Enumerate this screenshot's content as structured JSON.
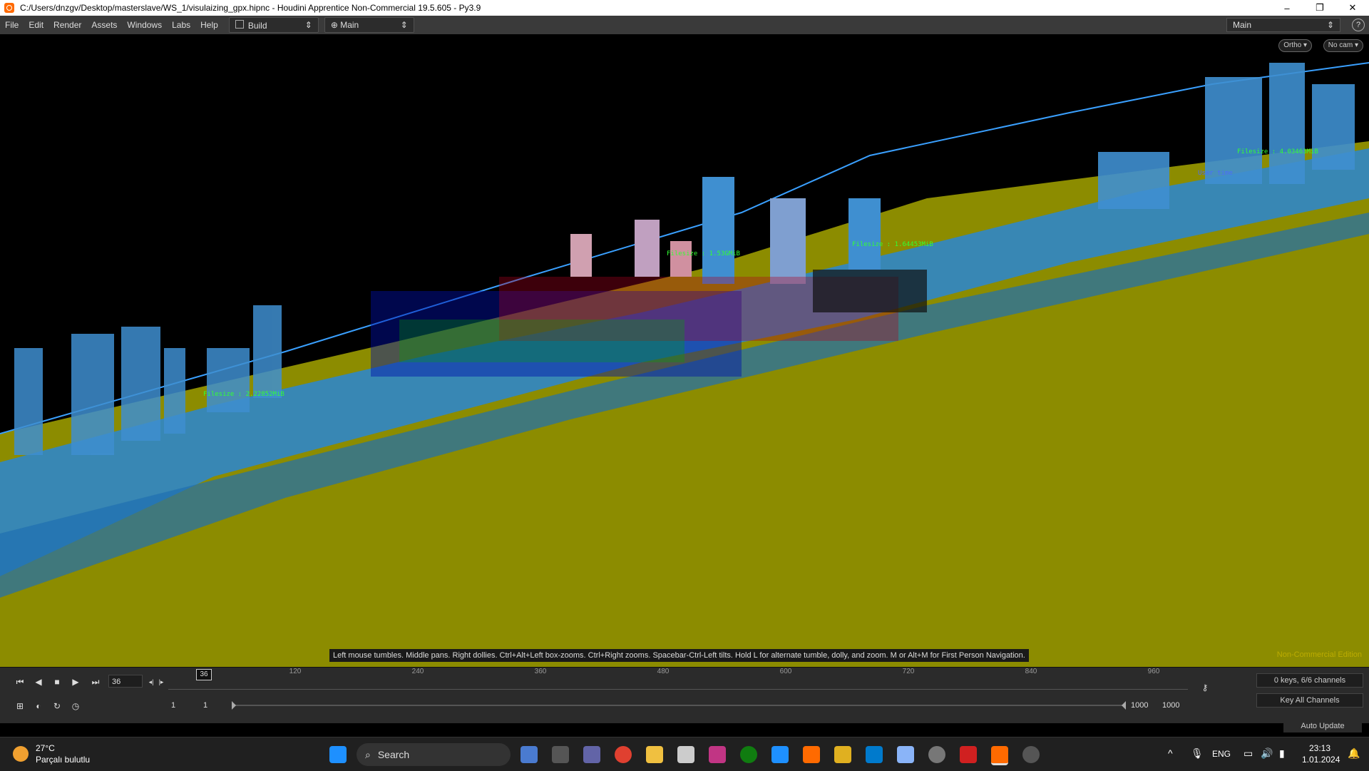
{
  "window": {
    "title": "C:/Users/dnzgv/Desktop/masterslave/WS_1/visulaizing_gpx.hipnc - Houdini Apprentice Non-Commercial 19.5.605 - Py3.9",
    "minimize": "–",
    "maximize": "❐",
    "close": "✕"
  },
  "menu": {
    "items": [
      "File",
      "Edit",
      "Render",
      "Assets",
      "Windows",
      "Labs",
      "Help"
    ],
    "desktop_build": "Build",
    "desktop_main": "Main",
    "right_desktop": "Main",
    "help_glyph": "?"
  },
  "viewport": {
    "ortho_label": "Ortho ▾",
    "cam_label": "No cam ▾",
    "hint": "Left mouse tumbles. Middle pans. Right dollies. Ctrl+Alt+Left box-zooms. Ctrl+Right zooms. Spacebar-Ctrl-Left tilts. Hold L for alternate tumble, dolly, and zoom.     M or Alt+M for First Person Navigation.",
    "edition": "Non-Commercial Edition",
    "ground_color": "#8c8c00",
    "terrain_color": "#2f86c8",
    "labels": [
      {
        "text": "Filesize : 1.53GMiB"
      },
      {
        "text": "Filesize : 1.64453MiB"
      },
      {
        "text": "Filesize : 2.22852MiB"
      },
      {
        "text": "Filesize : 4.03463MiB"
      },
      {
        "text": "User time"
      }
    ]
  },
  "playbar": {
    "current_frame": "36",
    "cursor_frame": "36",
    "ruler_labels": [
      "120",
      "240",
      "360",
      "480",
      "600",
      "720",
      "840",
      "960"
    ],
    "start_a": "1",
    "start_b": "1",
    "end_a": "1000",
    "end_b": "1000",
    "keys_info": "0 keys, 6/6 channels",
    "key_all": "Key All Channels",
    "auto_update": "Auto Update"
  },
  "taskbar": {
    "weather_temp": "27°C",
    "weather_desc": "Parçalı bulutlu",
    "search": "Search",
    "lang": "ENG",
    "time": "23:13",
    "date": "1.01.2024"
  }
}
